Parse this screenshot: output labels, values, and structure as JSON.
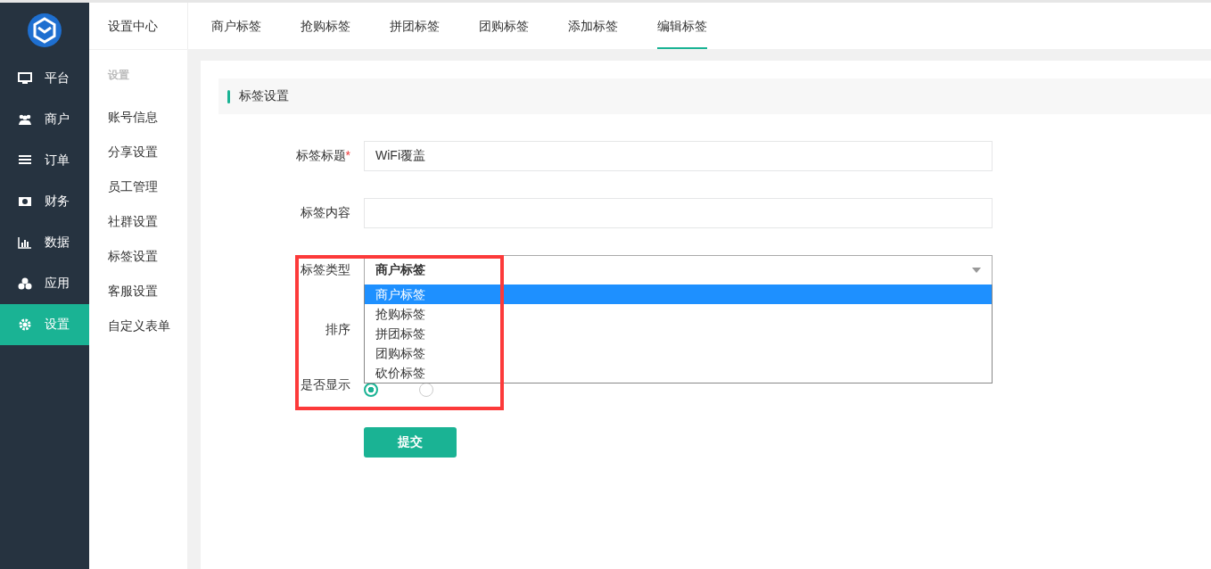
{
  "nav": [
    {
      "label": "平台",
      "selected": false
    },
    {
      "label": "商户",
      "selected": false
    },
    {
      "label": "订单",
      "selected": false
    },
    {
      "label": "财务",
      "selected": false
    },
    {
      "label": "数据",
      "selected": false
    },
    {
      "label": "应用",
      "selected": false
    },
    {
      "label": "设置",
      "selected": true
    }
  ],
  "sub_nav": {
    "title": "设置中心",
    "section": "设置",
    "items": [
      {
        "label": "账号信息"
      },
      {
        "label": "分享设置"
      },
      {
        "label": "员工管理"
      },
      {
        "label": "社群设置"
      },
      {
        "label": "标签设置"
      },
      {
        "label": "客服设置"
      },
      {
        "label": "自定义表单"
      }
    ]
  },
  "tabs": [
    {
      "label": "商户标签",
      "selected": false
    },
    {
      "label": "抢购标签",
      "selected": false
    },
    {
      "label": "拼团标签",
      "selected": false
    },
    {
      "label": "团购标签",
      "selected": false
    },
    {
      "label": "添加标签",
      "selected": false
    },
    {
      "label": "编辑标签",
      "selected": true
    }
  ],
  "section_title": "标签设置",
  "form": {
    "fields": [
      {
        "kind": "text",
        "label": "标签标题",
        "required_mark": "*",
        "value": "WiFi覆盖"
      },
      {
        "kind": "text",
        "label": "标签内容"
      },
      {
        "kind": "select",
        "label": "标签类型",
        "value": "商户标签",
        "expanded": true,
        "options": [
          {
            "label": "商户标签",
            "selected": true
          },
          {
            "label": "抢购标签",
            "selected": false
          },
          {
            "label": "拼团标签",
            "selected": false
          },
          {
            "label": "团购标签",
            "selected": false
          },
          {
            "label": "砍价标签",
            "selected": false
          }
        ]
      },
      {
        "kind": "covered",
        "label": "排序"
      },
      {
        "kind": "radio",
        "label": "是否显示",
        "options": [
          {
            "selected": true
          },
          {
            "selected": false
          }
        ]
      }
    ],
    "submit": "提交"
  },
  "annotation": {
    "kind": "frame",
    "color": "#fc3a3a"
  }
}
